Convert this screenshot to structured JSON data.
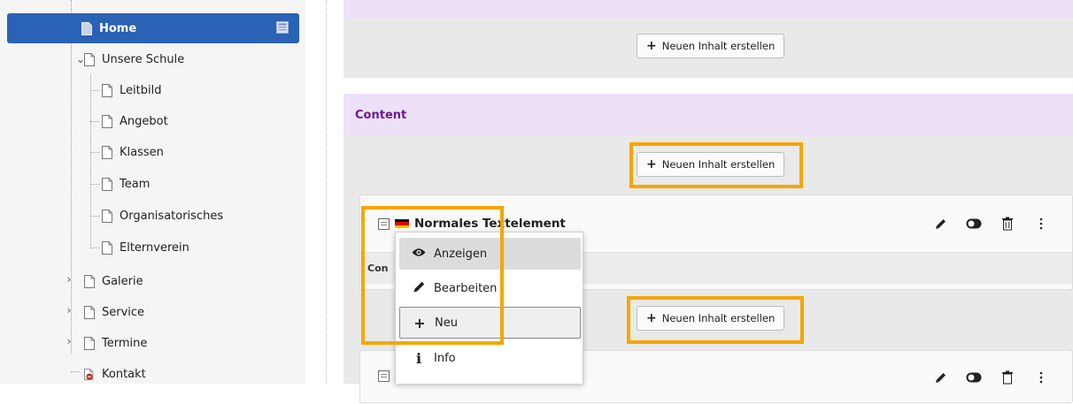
{
  "page_tree": {
    "selected": {
      "label": "Home"
    },
    "items": [
      {
        "label": "Unsere Schule",
        "toggle": "expanded"
      },
      {
        "label": "Leitbild"
      },
      {
        "label": "Angebot"
      },
      {
        "label": "Klassen"
      },
      {
        "label": "Team"
      },
      {
        "label": "Organisatorisches"
      },
      {
        "label": "Elternverein"
      },
      {
        "label": "Galerie",
        "toggle": "collapsed"
      },
      {
        "label": "Service",
        "toggle": "collapsed"
      },
      {
        "label": "Termine",
        "toggle": "collapsed"
      },
      {
        "label": "Kontakt"
      }
    ]
  },
  "content": {
    "new_content_label": "Neuen Inhalt erstellen",
    "column_title": "Content",
    "element": {
      "title": "Normales Textelement",
      "body_text": "Con"
    }
  },
  "context_menu": {
    "items": [
      {
        "label": "Anzeigen",
        "icon": "eye-icon"
      },
      {
        "label": "Bearbeiten",
        "icon": "pencil-icon"
      },
      {
        "label": "Neu",
        "icon": "plus-icon"
      },
      {
        "label": "Info",
        "icon": "info-icon"
      }
    ]
  },
  "colors": {
    "selected_bg": "#2a63b5",
    "column_header_bg": "#ece1f6",
    "column_title": "#6e1a8f",
    "highlight": "#f6a600"
  }
}
